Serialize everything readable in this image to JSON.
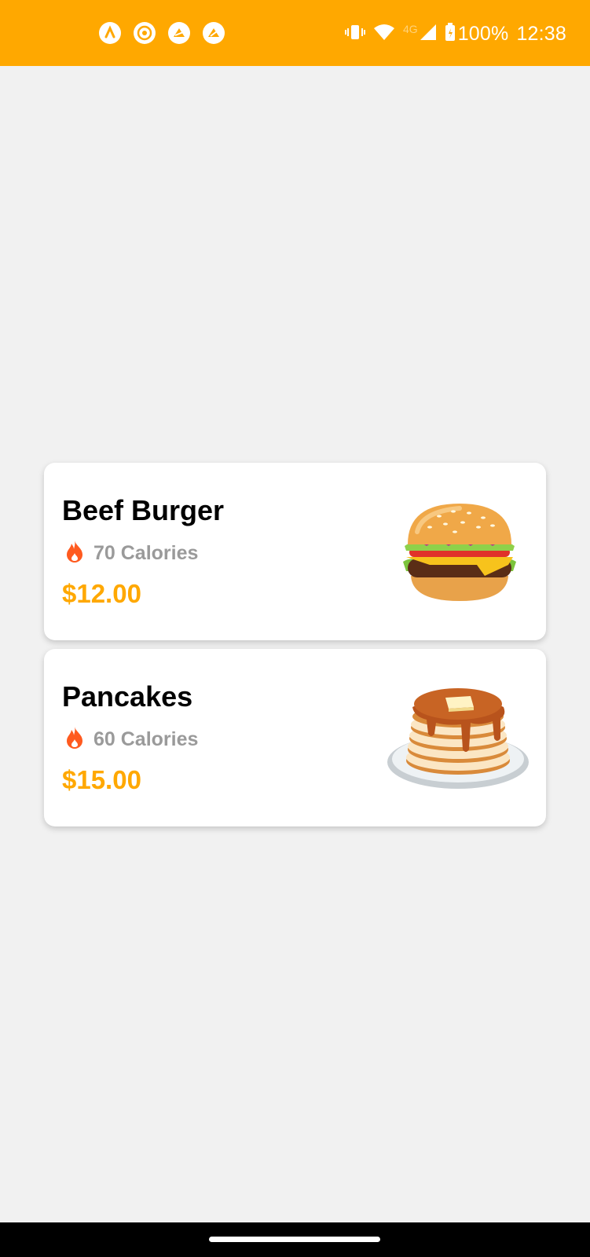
{
  "status_bar": {
    "background": "#ffa800",
    "notifications": [
      "app-notification-icon",
      "target-notification-icon",
      "ship-notification-icon",
      "sail-notification-icon"
    ],
    "network_label": "4G",
    "battery_percent": "100%",
    "time": "12:38"
  },
  "menu": {
    "items": [
      {
        "name": "Beef Burger",
        "calories": "70 Calories",
        "price": "$12.00",
        "image": "burger-image"
      },
      {
        "name": "Pancakes",
        "calories": "60 Calories",
        "price": "$15.00",
        "image": "pancakes-image"
      }
    ]
  },
  "colors": {
    "accent": "#ffa800",
    "flame": "#ff5a1f",
    "muted": "#9a9a9a"
  }
}
